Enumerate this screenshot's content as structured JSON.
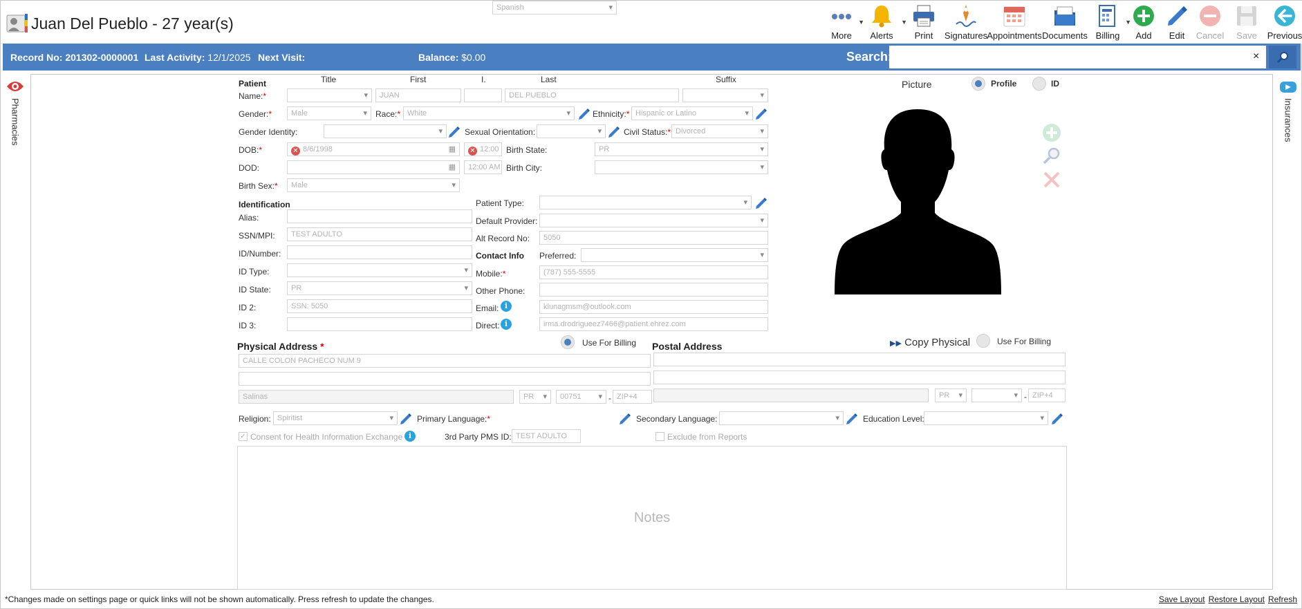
{
  "header": {
    "patient_title": "Juan Del Pueblo - 27 year(s)",
    "toolbar": [
      {
        "id": "more",
        "label": "More",
        "icon": "more-icon"
      },
      {
        "id": "alerts",
        "label": "Alerts",
        "icon": "bell-icon"
      },
      {
        "id": "print",
        "label": "Print",
        "icon": "printer-icon"
      },
      {
        "id": "signatures",
        "label": "Signatures",
        "icon": "signature-pen-icon"
      },
      {
        "id": "appointments",
        "label": "Appointments",
        "icon": "calendar-icon"
      },
      {
        "id": "documents",
        "label": "Documents",
        "icon": "documents-icon"
      },
      {
        "id": "billing",
        "label": "Billing",
        "icon": "billing-icon"
      },
      {
        "id": "add",
        "label": "Add",
        "icon": "add-icon"
      },
      {
        "id": "edit",
        "label": "Edit",
        "icon": "pencil-icon"
      },
      {
        "id": "cancel",
        "label": "Cancel",
        "icon": "cancel-icon"
      },
      {
        "id": "save",
        "label": "Save",
        "icon": "save-icon"
      },
      {
        "id": "previous",
        "label": "Previous",
        "icon": "back-arrow-icon"
      }
    ]
  },
  "info_bar": {
    "record_label": "Record No:",
    "record_value": "201302-0000001",
    "activity_label": "Last Activity:",
    "activity_value": "12/1/2025",
    "next_visit_label": "Next Visit:",
    "balance_label": "Balance:",
    "balance_value": "$0.00",
    "search_label": "Search:",
    "search_value": "",
    "clear": "×"
  },
  "side_tabs": {
    "left": "Pharmacies",
    "right": "Insurances"
  },
  "patient": {
    "section": "Patient",
    "col_title": "Title",
    "col_first": "First",
    "col_initial": "I.",
    "col_last": "Last",
    "col_suffix": "Suffix",
    "name_label": "Name:",
    "first": "JUAN",
    "last": "DEL PUEBLO",
    "gender_label": "Gender:",
    "gender": "Male",
    "race_label": "Race:",
    "race": "White",
    "ethnicity_label": "Ethnicity:",
    "ethnicity": "Hispanic or Latino",
    "gender_identity_label": "Gender Identity:",
    "sexual_orientation_label": "Sexual Orientation:",
    "civil_status_label": "Civil Status:",
    "civil_status": "Divorced",
    "dob_label": "DOB:",
    "dob": "8/6/1998",
    "dob_time": "12:00",
    "birth_state_label": "Birth State:",
    "birth_state": "PR",
    "dod_label": "DOD:",
    "dod_time": "12:00 AM",
    "birth_city_label": "Birth City:",
    "birth_sex_label": "Birth Sex:",
    "birth_sex": "Male",
    "required_mark": "*"
  },
  "identification": {
    "section": "Identification",
    "alias_label": "Alias:",
    "ssn_label": "SSN/MPI:",
    "ssn": "TEST ADULTO",
    "id_number_label": "ID/Number:",
    "id_type_label": "ID Type:",
    "id_state_label": "ID State:",
    "id_state": "PR",
    "id2_label": "ID 2:",
    "id2": "SSN: 5050",
    "id3_label": "ID 3:",
    "patient_type_label": "Patient Type:",
    "default_provider_label": "Default Provider:",
    "alt_record_label": "Alt Record No:",
    "alt_record": "5050"
  },
  "contact": {
    "section": "Contact Info",
    "preferred_label": "Preferred:",
    "mobile_label": "Mobile:",
    "mobile": "(787) 555-5555",
    "other_phone_label": "Other Phone:",
    "email_label": "Email:",
    "email": "klunagmsm@outlook.com",
    "direct_label": "Direct:",
    "direct": "irma.drodrigueez7466@patient.ehrez.com"
  },
  "picture": {
    "label": "Picture",
    "profile_option": "Profile",
    "id_option": "ID"
  },
  "physical_address": {
    "section": "Physical Address",
    "use_for_billing": "Use For Billing",
    "line1": "CALLE COLON PACHECO NUM 9",
    "city": "Salinas",
    "state": "PR",
    "zip": "00751",
    "zip4_placeholder": "ZIP+4",
    "dash": "-"
  },
  "postal_address": {
    "section": "Postal Address",
    "copy_physical": "Copy Physical",
    "use_for_billing": "Use For Billing",
    "state": "PR",
    "zip4_placeholder": "ZIP+4",
    "dash": "-"
  },
  "other": {
    "religion_label": "Religion:",
    "religion": "Spiritist",
    "primary_language_label": "Primary Language:",
    "primary_language": "Spanish",
    "secondary_language_label": "Secondary Language:",
    "education_label": "Education Level:",
    "consent_label": "Consent for Health Information Exchange",
    "pms_label": "3rd Party PMS ID:",
    "pms_value": "TEST ADULTO",
    "exclude_label": "Exclude from Reports",
    "notes_placeholder": "Notes"
  },
  "footer": {
    "note": "*Changes made on settings page or quick links will not be shown automatically. Press refresh to update the changes.",
    "save_layout": "Save Layout",
    "restore_layout": "Restore Layout",
    "refresh": "Refresh"
  },
  "colors": {
    "accent": "#4a7fc1",
    "required": "#dd0000",
    "add": "#2eab4f",
    "cancel": "#e36b6b"
  }
}
